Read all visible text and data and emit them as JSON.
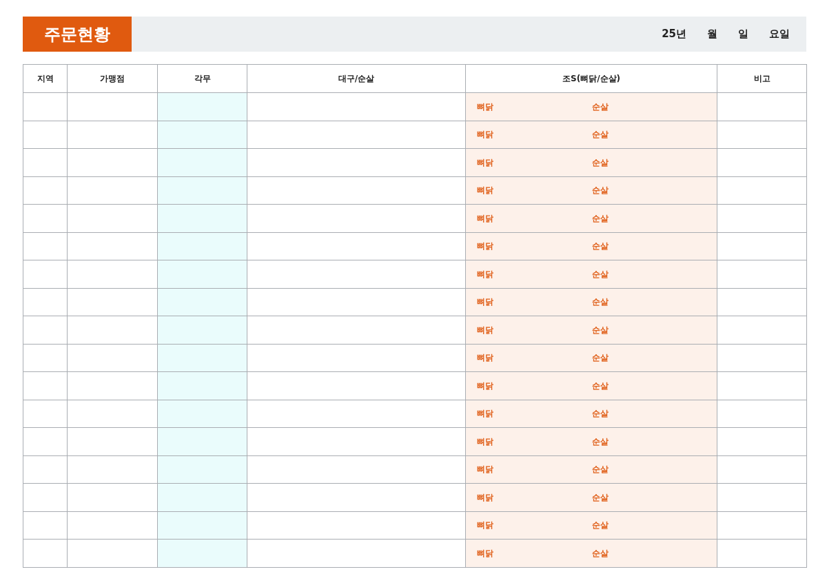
{
  "title": "주문현황",
  "date": [
    "25년",
    "월",
    "일",
    "요일"
  ],
  "table": {
    "columns": [
      "지역",
      "가맹점",
      "각무",
      "대구/순살",
      "조S(뼈닭/순살)",
      "비고"
    ],
    "rows": [
      {
        "bone": "뼈닭",
        "boneless": "순살"
      },
      {
        "bone": "뼈닭",
        "boneless": "순살"
      },
      {
        "bone": "뼈닭",
        "boneless": "순살"
      },
      {
        "bone": "뼈닭",
        "boneless": "순살"
      },
      {
        "bone": "뼈닭",
        "boneless": "순살"
      },
      {
        "bone": "뼈닭",
        "boneless": "순살"
      },
      {
        "bone": "뼈닭",
        "boneless": "순살"
      },
      {
        "bone": "뼈닭",
        "boneless": "순살"
      },
      {
        "bone": "뼈닭",
        "boneless": "순살"
      },
      {
        "bone": "뼈닭",
        "boneless": "순살"
      },
      {
        "bone": "뼈닭",
        "boneless": "순살"
      },
      {
        "bone": "뼈닭",
        "boneless": "순살"
      },
      {
        "bone": "뼈닭",
        "boneless": "순살"
      },
      {
        "bone": "뼈닭",
        "boneless": "순살"
      },
      {
        "bone": "뼈닭",
        "boneless": "순살"
      },
      {
        "bone": "뼈닭",
        "boneless": "순살"
      },
      {
        "bone": "뼈닭",
        "boneless": "순살"
      }
    ]
  }
}
